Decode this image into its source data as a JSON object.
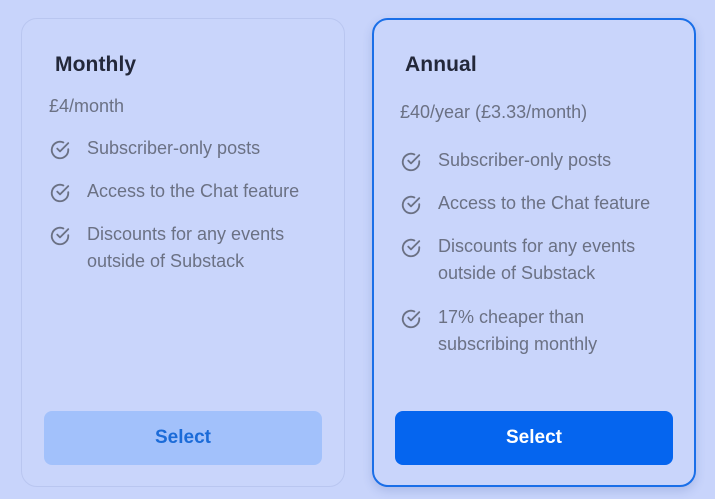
{
  "plans": {
    "monthly": {
      "title": "Monthly",
      "price": "£4/month",
      "features": [
        {
          "text": "Subscriber-only posts",
          "icon": "check-circle-icon"
        },
        {
          "text": "Access to the Chat feature",
          "icon": "check-circle-icon"
        },
        {
          "text": "Discounts for any events outside of Substack",
          "icon": "check-circle-icon"
        }
      ],
      "button_label": "Select",
      "selected": false
    },
    "annual": {
      "title": "Annual",
      "price": "£40/year (£3.33/month)",
      "features": [
        {
          "text": "Subscriber-only posts",
          "icon": "check-circle-icon"
        },
        {
          "text": "Access to the Chat feature",
          "icon": "check-circle-icon"
        },
        {
          "text": "Discounts for any events outside of Substack",
          "icon": "check-circle-icon"
        },
        {
          "text": "17% cheaper than subscribing monthly",
          "icon": "check-circle-icon"
        }
      ],
      "button_label": "Select",
      "selected": true
    }
  },
  "colors": {
    "background": "#c8d4fb",
    "accent": "#0565ef",
    "selected_border": "#1a6fe8",
    "secondary_button": "#a2c1fb",
    "muted_text": "#6b7184",
    "heading_text": "#23283a"
  }
}
